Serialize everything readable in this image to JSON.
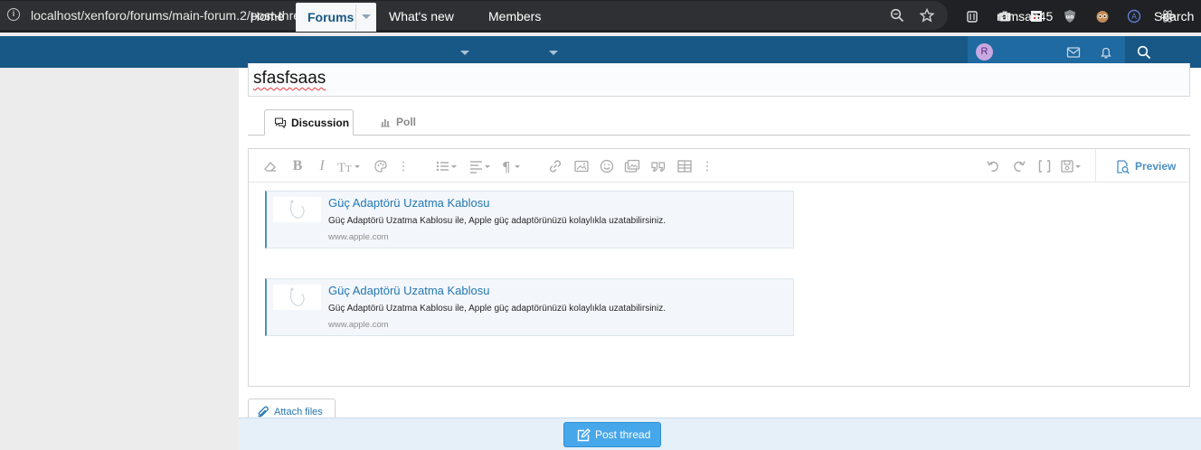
{
  "browser": {
    "url": "localhost/xenforo/forums/main-forum.2/post-thread",
    "info_icon": "info-icon",
    "toolbar_icons": [
      "zoom-icon",
      "bookmark-star-icon"
    ],
    "extension_icons": [
      "extension-jar-icon",
      "camera-icon",
      "pixel-face-icon",
      "ublock-icon",
      "owl-icon",
      "circle-a-icon",
      "react-icon"
    ]
  },
  "nav": {
    "home": "Home",
    "forums": "Forums",
    "whats_new": "What's new",
    "members": "Members",
    "username": "ramsan45",
    "avatar_letter": "R",
    "search": "Search"
  },
  "thread": {
    "title_value": "sfasfsaas"
  },
  "tabs": [
    {
      "label": "Discussion",
      "icon": "chat-bubbles-icon",
      "active": true
    },
    {
      "label": "Poll",
      "icon": "bar-chart-icon",
      "active": false
    }
  ],
  "editor": {
    "toolbar": [
      "eraser-icon",
      "bold-icon",
      "italic-icon",
      "text-size-icon",
      "palette-icon",
      "more-icon",
      "list-icon",
      "align-icon",
      "paragraph-icon",
      "link-icon",
      "image-icon",
      "smilie-icon",
      "media-icon",
      "quote-icon",
      "table-icon",
      "more-icon"
    ],
    "toolbar_right": [
      "undo-icon",
      "redo-icon",
      "bbcode-icon",
      "drafts-icon"
    ],
    "preview_label": "Preview",
    "embeds": [
      {
        "title": "Güç Adaptörü Uzatma Kablosu",
        "description": "Güç Adaptörü Uzatma Kablosu ile, Apple güç adaptörünüzü kolaylıkla uzatabilirsiniz.",
        "domain": "www.apple.com"
      },
      {
        "title": "Güç Adaptörü Uzatma Kablosu",
        "description": "Güç Adaptörü Uzatma Kablosu ile, Apple güç adaptörünüzü kolaylıkla uzatabilirsiniz.",
        "domain": "www.apple.com"
      }
    ]
  },
  "attach_label": "Attach files",
  "submit_label": "Post thread",
  "colors": {
    "nav_bg": "#185886",
    "accent": "#47a7eb",
    "link": "#2577b1"
  }
}
